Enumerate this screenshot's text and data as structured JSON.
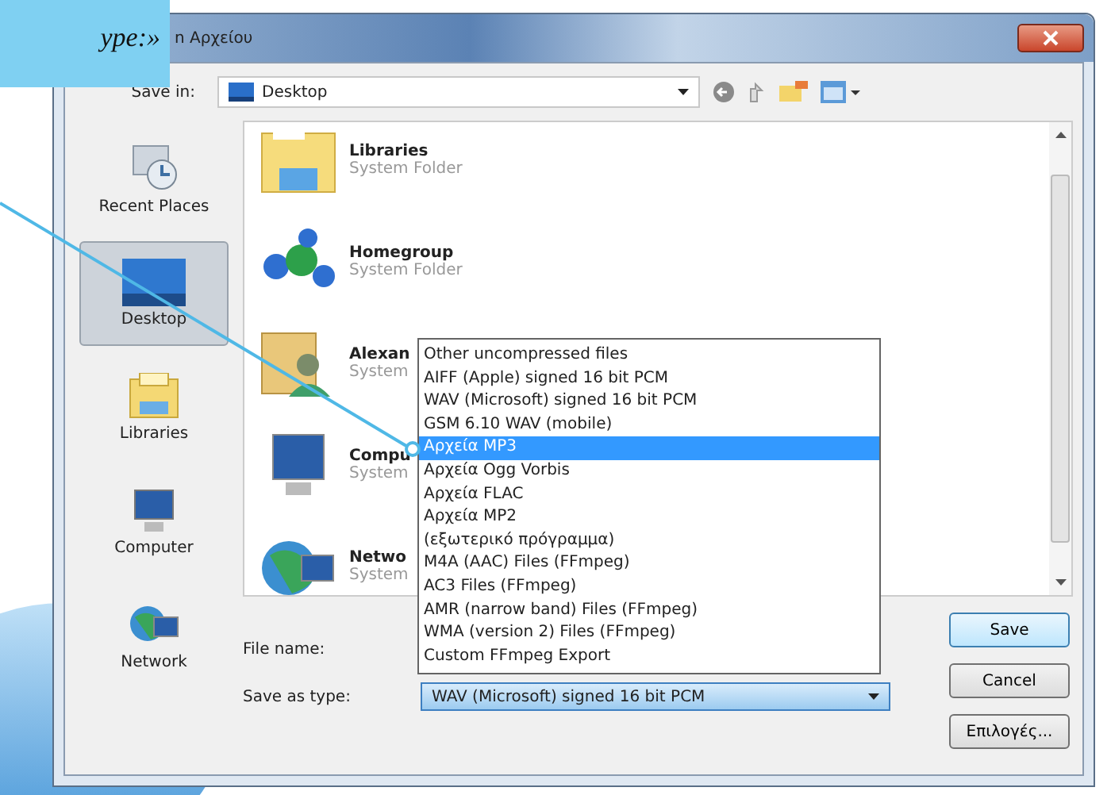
{
  "callout": {
    "text": "ype:»"
  },
  "window": {
    "title": "n Αρχείου"
  },
  "save_in": {
    "label": "Save in:",
    "value": "Desktop"
  },
  "places": [
    {
      "kind": "recent",
      "label": "Recent Places",
      "selected": false
    },
    {
      "kind": "desktop",
      "label": "Desktop",
      "selected": true
    },
    {
      "kind": "libraries",
      "label": "Libraries",
      "selected": false
    },
    {
      "kind": "computer",
      "label": "Computer",
      "selected": false
    },
    {
      "kind": "network",
      "label": "Network",
      "selected": false
    }
  ],
  "files": [
    {
      "kind": "folder",
      "name": "Libraries",
      "type": "System Folder"
    },
    {
      "kind": "homegroup",
      "name": "Homegroup",
      "type": "System Folder"
    },
    {
      "kind": "user",
      "name": "Alexan",
      "type": "System"
    },
    {
      "kind": "computer",
      "name": "Compu",
      "type": "System"
    },
    {
      "kind": "network",
      "name": "Netwo",
      "type": "System"
    }
  ],
  "file_name": {
    "label": "File name:"
  },
  "save_as_type": {
    "label": "Save as type:",
    "value": "WAV (Microsoft) signed 16 bit PCM"
  },
  "type_options": [
    {
      "label": "Other uncompressed files",
      "selected": false
    },
    {
      "label": "AIFF (Apple) signed 16 bit PCM",
      "selected": false
    },
    {
      "label": "WAV (Microsoft) signed 16 bit PCM",
      "selected": false
    },
    {
      "label": "GSM 6.10 WAV (mobile)",
      "selected": false
    },
    {
      "label": "Αρχεία MP3",
      "selected": true
    },
    {
      "label": "Αρχεία Ogg Vorbis",
      "selected": false
    },
    {
      "label": "Αρχεία FLAC",
      "selected": false
    },
    {
      "label": "Αρχεία MP2",
      "selected": false
    },
    {
      "label": "(εξωτερικό πρόγραμμα)",
      "selected": false
    },
    {
      "label": "M4A (AAC) Files (FFmpeg)",
      "selected": false
    },
    {
      "label": "AC3 Files (FFmpeg)",
      "selected": false
    },
    {
      "label": "AMR (narrow band) Files (FFmpeg)",
      "selected": false
    },
    {
      "label": "WMA (version 2) Files (FFmpeg)",
      "selected": false
    },
    {
      "label": "Custom FFmpeg Export",
      "selected": false
    }
  ],
  "buttons": [
    "Save",
    "Cancel",
    "Επιλογές..."
  ]
}
